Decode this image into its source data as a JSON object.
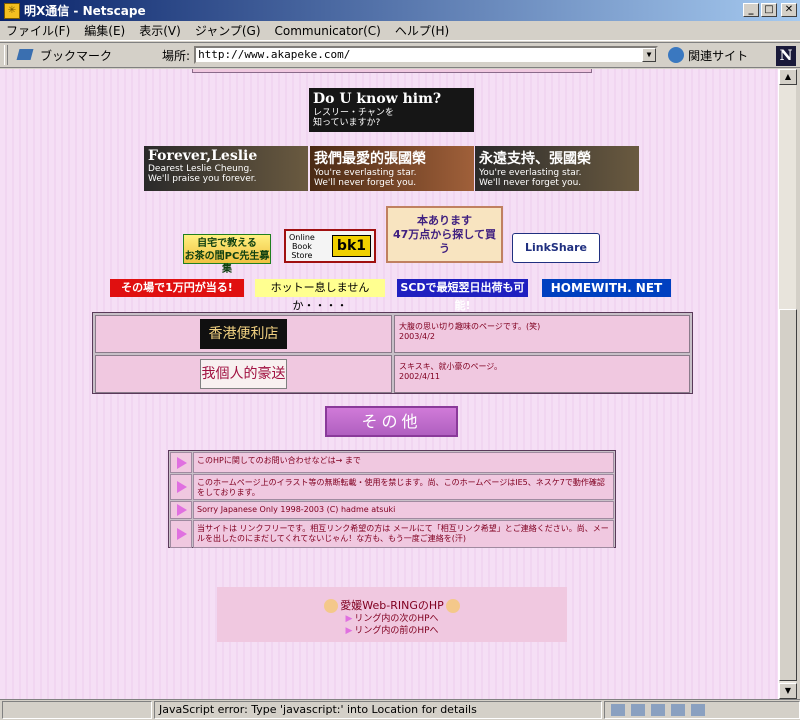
{
  "window": {
    "title": "明X通信 - Netscape"
  },
  "menu": [
    "ファイル(F)",
    "編集(E)",
    "表示(V)",
    "ジャンプ(G)",
    "Communicator(C)",
    "ヘルプ(H)"
  ],
  "toolbar": {
    "bookmarks": "ブックマーク",
    "location_label": "場所:",
    "url": "http://www.akapeke.com/",
    "related": "関連サイト"
  },
  "banners": {
    "dou_title": "Do U know him?",
    "dou_sub": "レスリー・チャンを\n知っていますか?",
    "leslie": [
      {
        "title": "Forever,Leslie",
        "line1": "Dearest Leslie Cheung.",
        "line2": "We'll praise you forever."
      },
      {
        "title": "我們最愛的張國榮",
        "line1": "You're everlasting star.",
        "line2": "We'll never forget you."
      },
      {
        "title": "永遠支持、張國榮",
        "line1": "You're everlasting star.",
        "line2": "We'll never forget you."
      }
    ]
  },
  "ads": {
    "ad1_line1": "自宅で教える",
    "ad1_line2": "お茶の間PC先生募集",
    "ad2_left": "Online\nBook\nStore",
    "ad2_brand": "bk1",
    "ad3_line1": "本あります",
    "ad3_line2": "47万点から探して買う",
    "ad4": "LinkShare",
    "pill1": "その場で1万円が当る!",
    "pill2": "ホットー息しませんか・・・・",
    "pill3": "SCDで最短翌日出荷も可能!",
    "pill4": "HOMEWITH. NET"
  },
  "shops": [
    {
      "logo": "香港便利店",
      "desc": "大腹の思い切り趣味のページです。(笑)",
      "date": "2003/4/2"
    },
    {
      "logo": "我個人的豪送",
      "desc": "スキスキ、就小豪のページ。",
      "date": "2002/4/11"
    }
  ],
  "other_button": "その他",
  "info": [
    "このHPに関してのお問い合わせなどは→   まで",
    "このホームページ上のイラスト等の無断転載・使用を禁じます。尚、このホームページはIE5、ネスケ7で動作確認をしております。",
    "Sorry Japanese Only  1998-2003 (C) hadme atsuki",
    "当サイトは リンクフリーです。相互リンク希望の方は メールにて「相互リンク希望」とご連絡ください。尚、メールを出したのにまだしてくれてないじゃん！な方も、もう一度ご連絡を(汗)"
  ],
  "ring": {
    "title": "愛媛Web-RINGのHP",
    "next": "リング内の次のHPへ",
    "prev": "リング内の前のHPへ"
  },
  "status": {
    "text": "JavaScript error: Type 'javascript:' into Location for details"
  }
}
